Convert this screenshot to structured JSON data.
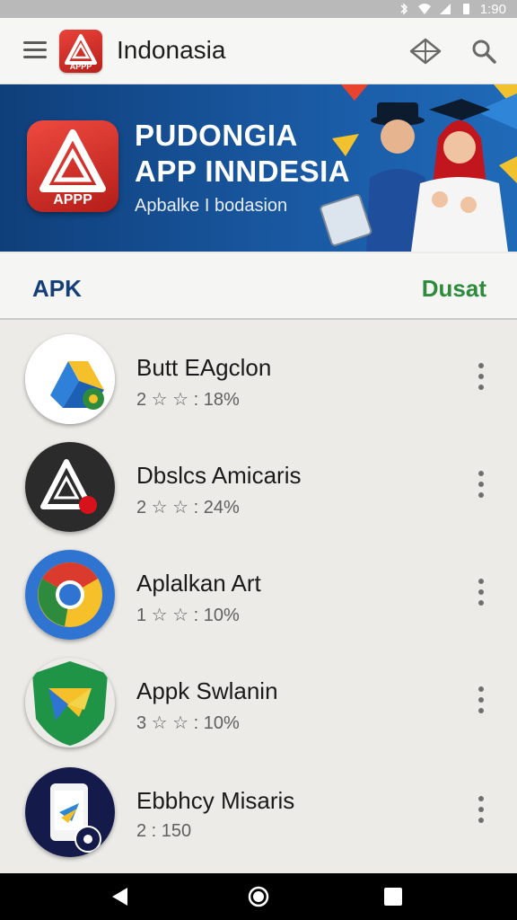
{
  "status_bar": {
    "time": "1:90"
  },
  "app_bar": {
    "title": "Indonasia"
  },
  "banner": {
    "title_line1": "PUDONGIA",
    "title_line2": "APP INNDESIA",
    "subtitle": "Apbalke I bodasion",
    "logo_text": "APPP"
  },
  "header_logo_text": "APPP",
  "tabs": {
    "left": "APK",
    "right": "Dusat"
  },
  "apps": [
    {
      "name": "Butt EAgclon",
      "meta": "2 ☆ ☆ : 18%",
      "icon": "drive-icon"
    },
    {
      "name": "Dbslcs Amicaris",
      "meta": "2 ☆ ☆ : 24%",
      "icon": "dark-triangle-icon"
    },
    {
      "name": "Aplalkan Art",
      "meta": "1 ☆ ☆ : 10%",
      "icon": "chrome-icon"
    },
    {
      "name": "Appk Swlanin",
      "meta": "3 ☆ ☆ : 10%",
      "icon": "shield-folder-icon"
    },
    {
      "name": "Ebbhcy Misaris",
      "meta": "2 : 150",
      "icon": "phone-icon"
    }
  ],
  "colors": {
    "brand_red": "#d7332b",
    "banner_blue": "#1a5aa4",
    "tab_blue": "#163e78",
    "tab_green": "#2e8b3e"
  }
}
